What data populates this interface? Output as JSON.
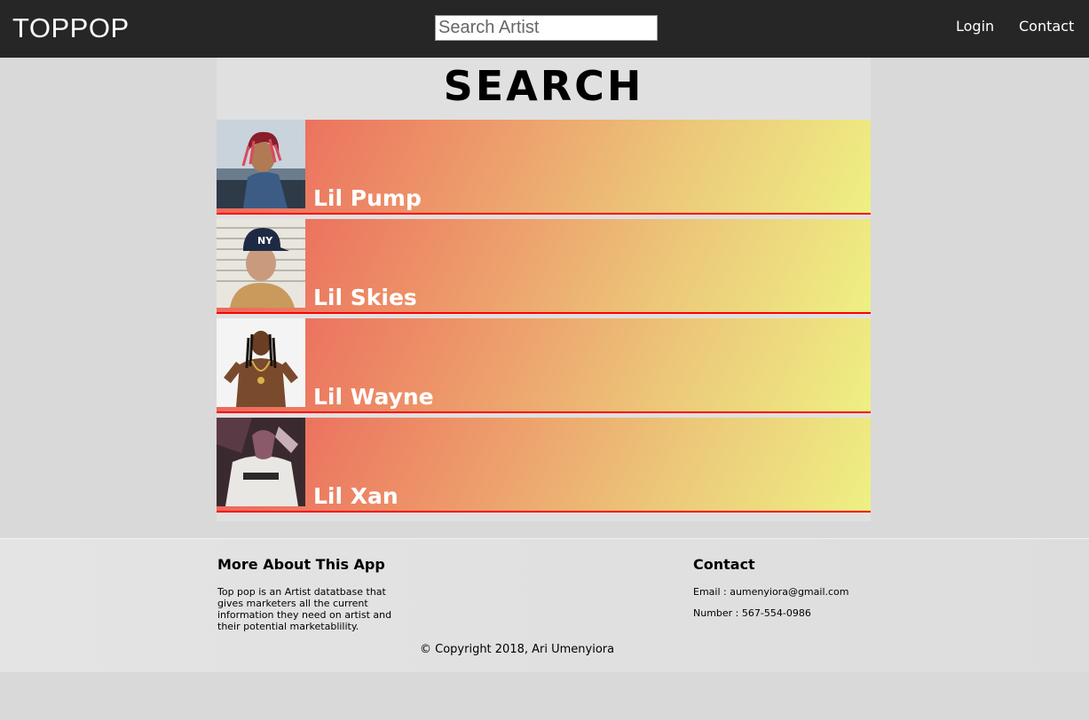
{
  "navbar": {
    "brand": "TOPPOP",
    "search_placeholder": "Search Artist",
    "links": {
      "login": "Login",
      "contact": "Contact"
    }
  },
  "main": {
    "title": "SEARCH",
    "artists": [
      {
        "name": "Lil Pump"
      },
      {
        "name": "Lil Skies"
      },
      {
        "name": "Lil Wayne"
      },
      {
        "name": "Lil Xan"
      }
    ]
  },
  "footer": {
    "about_heading": "More About This App",
    "about_text": "Top pop is an Artist datatbase that gives marketers all the current information they need on artist and their potential marketablility.",
    "contact_heading": "Contact",
    "email": "Email : aumenyiora@gmail.com",
    "number": "Number : 567-554-0986",
    "copyright": "© Copyright 2018, Ari Umenyiora"
  },
  "colors": {
    "navbar_bg": "#262626",
    "row_gradient_start": "#ec6059",
    "row_gradient_end": "#eef083",
    "row_border": "#ff0000"
  }
}
